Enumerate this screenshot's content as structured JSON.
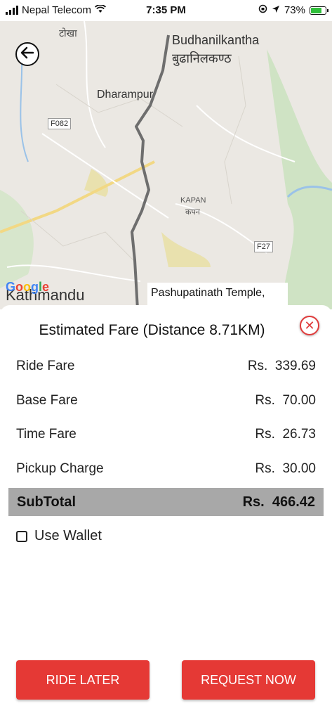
{
  "status_bar": {
    "carrier": "Nepal Telecom",
    "time": "7:35 PM",
    "battery": "73%"
  },
  "map": {
    "labels": {
      "tokha": "टोखा",
      "budhanilkantha_en": "Budhanilkantha",
      "budhanilkantha_ne": "बुढानिलकण्ठ",
      "dharampur": "Dharampur",
      "kapan_en": "KAPAN",
      "kapan_ne": "कपन",
      "kathmandu": "Kathmandu",
      "road_f082": "F082",
      "road_f27": "F27"
    },
    "google_logo": "Google",
    "destination": "Pashupatinath Temple,"
  },
  "fare": {
    "title": "Estimated Fare (Distance 8.71KM)",
    "rows": [
      {
        "label": "Ride Fare",
        "currency": "Rs.",
        "amount": "339.69"
      },
      {
        "label": "Base Fare",
        "currency": "Rs.",
        "amount": "70.00"
      },
      {
        "label": "Time Fare",
        "currency": "Rs.",
        "amount": "26.73"
      },
      {
        "label": "Pickup Charge",
        "currency": "Rs.",
        "amount": "30.00"
      }
    ],
    "subtotal": {
      "label": "SubTotal",
      "currency": "Rs.",
      "amount": "466.42"
    },
    "wallet_label": "Use Wallet",
    "wallet_checked": false
  },
  "actions": {
    "ride_later": "RIDE LATER",
    "request_now": "REQUEST NOW"
  },
  "colors": {
    "accent": "#e53935",
    "subtotal_bg": "#a8a8a8",
    "map_bg": "#ebe8e3"
  }
}
